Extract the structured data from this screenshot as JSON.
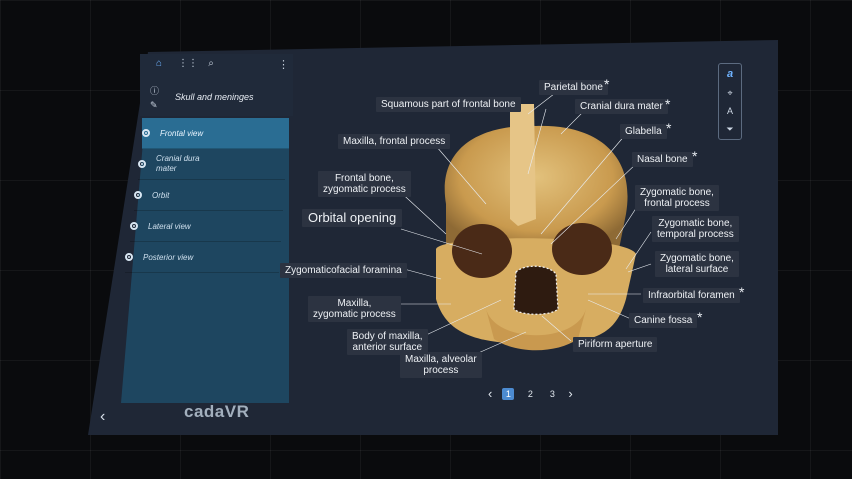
{
  "toolbar": {
    "home_icon": "home-icon",
    "grid_icon": "grid-icon",
    "search_icon": "search-icon",
    "menu_icon": "kebab-icon"
  },
  "sidebar": {
    "section_title": "Skull and meninges",
    "views": [
      {
        "label": "Frontal view",
        "active": true
      },
      {
        "label": "Cranial dura\nmater",
        "active": false
      },
      {
        "label": "Orbit",
        "active": false
      },
      {
        "label": "Lateral view",
        "active": false
      },
      {
        "label": "Posterior view",
        "active": false
      }
    ],
    "logo": "cadaVR"
  },
  "labels": {
    "parietal_bone": "Parietal bone",
    "squamous_frontal": "Squamous part of frontal bone",
    "cranial_dura": "Cranial dura mater",
    "maxilla_frontal": "Maxilla, frontal process",
    "glabella": "Glabella",
    "nasal_bone": "Nasal bone",
    "frontal_zygomatic": "Frontal bone,\nzygomatic process",
    "zygomatic_frontal": "Zygomatic bone,\nfrontal process",
    "orbital_opening": "Orbital opening",
    "zygomatic_temporal": "Zygomatic bone,\ntemporal process",
    "zygomaticofacial": "Zygomaticofacial foramina",
    "zygomatic_lateral": "Zygomatic bone,\nlateral surface",
    "maxilla_zygomatic": "Maxilla,\nzygomatic process",
    "infraorbital": "Infraorbital foramen",
    "canine_fossa": "Canine fossa",
    "body_maxilla": "Body of maxilla,\nanterior surface",
    "piriform": "Piriform aperture",
    "alveolar": "Maxilla, alveolar\nprocess",
    "star": "*"
  },
  "pager": {
    "pages": [
      "1",
      "2",
      "3"
    ],
    "current": "1"
  },
  "colors": {
    "panel": "#1f2736",
    "sidebar_list": "#1e4660",
    "active_item": "#2a6d93",
    "accent": "#4c8bd1",
    "label_bg": "#2c3341",
    "bone": "#d8b36a"
  }
}
